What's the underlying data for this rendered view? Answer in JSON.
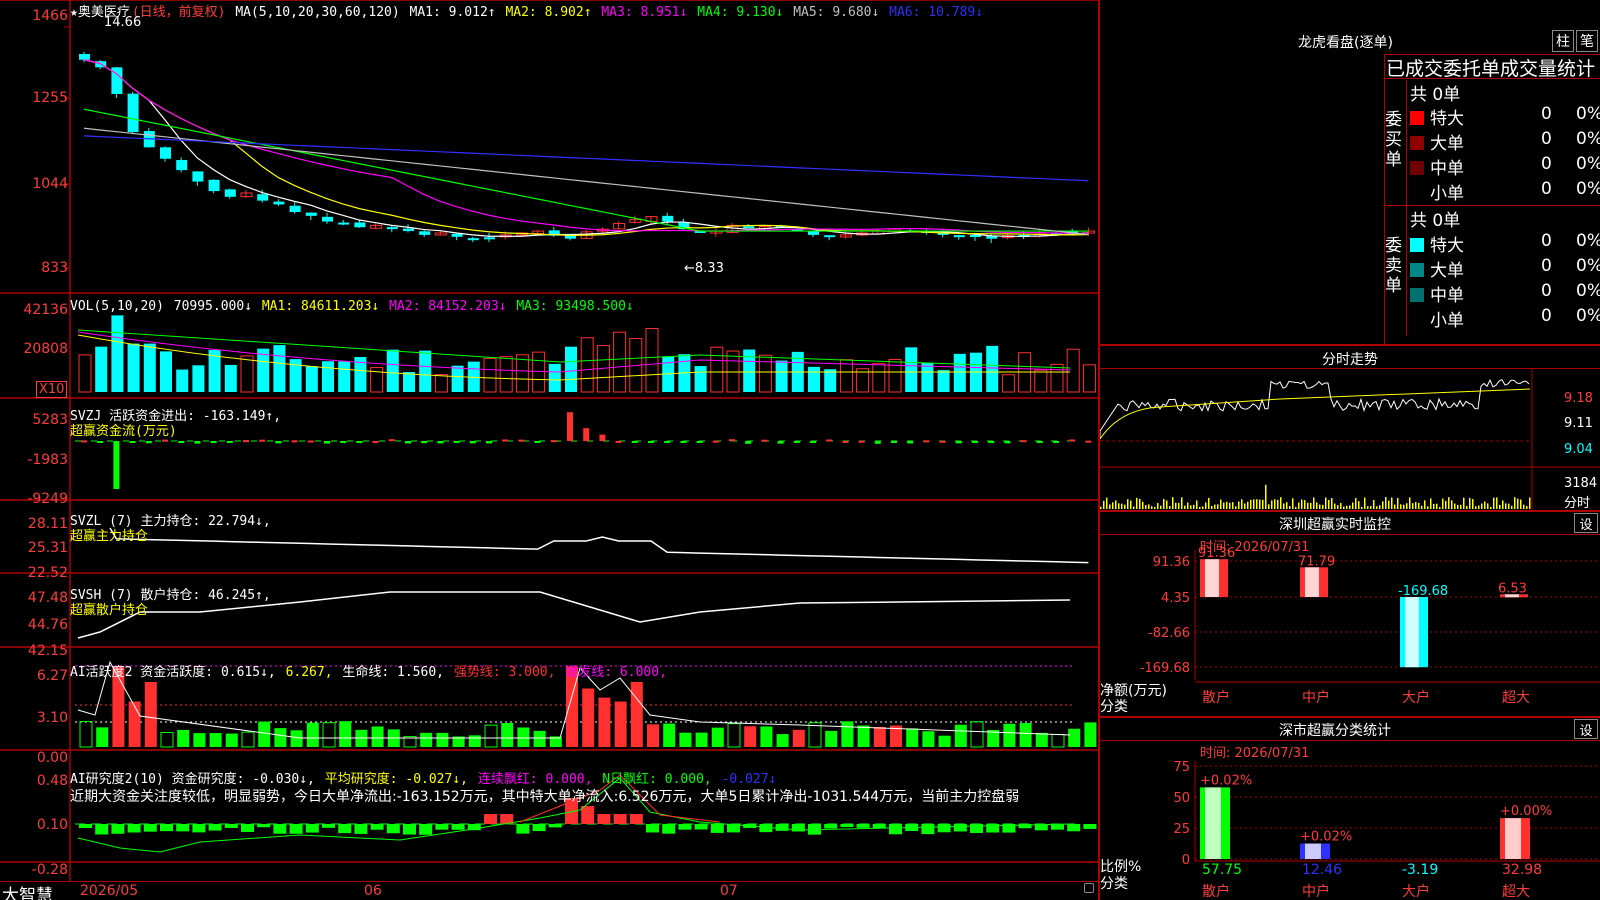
{
  "stock": {
    "name": "★奥美医疗",
    "mode": "(日线，前复权)",
    "high_label": "14.66",
    "low_label": "←8.33"
  },
  "ma": {
    "label": "MA(5,10,20,30,60,120)",
    "items": [
      {
        "text": "MA1: 9.012↑",
        "color": "#ffffff"
      },
      {
        "text": "MA2: 8.902↑",
        "color": "#ffff00"
      },
      {
        "text": "MA3: 8.951↓",
        "color": "#ff00ff"
      },
      {
        "text": "MA4: 9.130↓",
        "color": "#00ff00"
      },
      {
        "text": "MA5: 9.680↓",
        "color": "#c0c0c0"
      },
      {
        "text": "MA6: 10.789↓",
        "color": "#3030ff"
      }
    ]
  },
  "price_axis": [
    "1466",
    "1255",
    "1044",
    "833"
  ],
  "vol": {
    "label": "VOL(5,10,20)",
    "value": "70995.000↓",
    "items": [
      {
        "text": "MA1: 84611.203↓",
        "color": "#ffff00"
      },
      {
        "text": "MA2: 84152.203↓",
        "color": "#ff00ff"
      },
      {
        "text": "MA3: 93498.500↓",
        "color": "#00ff00"
      }
    ],
    "axis": [
      "42136",
      "20808"
    ],
    "unit": "X10"
  },
  "svzj": {
    "label": "SVZJ  活跃资金进出: -163.149↑,",
    "sub": "超赢资金流(万元)",
    "axis": [
      "5283",
      "-1983",
      "-9249"
    ]
  },
  "svzl": {
    "label": "SVZL (7) 主力持仓: 22.794↓,",
    "sub": "超赢主力持仓",
    "axis": [
      "28.11",
      "25.31",
      "22.52"
    ]
  },
  "svsh": {
    "label": "SVSH (7) 散户持仓: 46.245↑,",
    "sub": "超赢散户持仓",
    "axis": [
      "47.48",
      "44.76",
      "42.15"
    ]
  },
  "ai1": {
    "items": [
      {
        "text": "AI活跃度2 资金活跃度: 0.615↓,",
        "color": "#ffffff"
      },
      {
        "text": "6.267,",
        "color": "#ffff00"
      },
      {
        "text": "生命线: 1.560,",
        "color": "#ffffff"
      },
      {
        "text": "强势线: 3.000,",
        "color": "#ff3030"
      },
      {
        "text": "爆发线: 6.000,",
        "color": "#ff00ff"
      }
    ],
    "axis": [
      "6.27",
      "3.10",
      "0.00"
    ]
  },
  "ai2": {
    "items": [
      {
        "text": "AI研究度2(10) 资金研究度: -0.030↓,",
        "color": "#ffffff"
      },
      {
        "text": "平均研究度: -0.027↓,",
        "color": "#ffff00"
      },
      {
        "text": "连续飘红: 0.000,",
        "color": "#ff00ff"
      },
      {
        "text": "N日飘红: 0.000,",
        "color": "#00ff00"
      },
      {
        "text": "-0.027↓",
        "color": "#3030ff"
      }
    ],
    "desc": "近期大资金关注度较低，明显弱势，今日大单净流出:-163.152万元，其中特大单净流入:6.526万元，大单5日累计净出-1031.544万元，当前主力控盘弱",
    "axis": [
      "0.48",
      "0.10",
      "-0.28"
    ]
  },
  "date_axis": [
    "2026/05",
    "06",
    "07"
  ],
  "brand": "大智慧",
  "right": {
    "lhkp_title": "龙虎看盘(逐单)",
    "btn_bar": "柱",
    "btn_pen": "笔",
    "tabs_line": "已成交委托单成交量统计",
    "buy": {
      "group": "委买单",
      "total": "共 0单",
      "rows": [
        {
          "label": "特大",
          "count": "0",
          "pct": "0%",
          "color": "#ff0000"
        },
        {
          "label": "大单",
          "count": "0",
          "pct": "0%",
          "color": "#900000"
        },
        {
          "label": "中单",
          "count": "0",
          "pct": "0%",
          "color": "#700000"
        },
        {
          "label": "小单",
          "count": "0",
          "pct": "0%",
          "color": ""
        }
      ]
    },
    "sell": {
      "group": "委卖单",
      "total": "共 0单",
      "rows": [
        {
          "label": "特大",
          "count": "0",
          "pct": "0%",
          "color": "#00ffff"
        },
        {
          "label": "大单",
          "count": "0",
          "pct": "0%",
          "color": "#008888"
        },
        {
          "label": "中单",
          "count": "0",
          "pct": "0%",
          "color": "#007070"
        },
        {
          "label": "小单",
          "count": "0",
          "pct": "0%",
          "color": ""
        }
      ]
    },
    "fenshi": {
      "title": "分时走势",
      "axis": [
        "9.18",
        "9.11",
        "9.04"
      ],
      "vol_label": "3184",
      "vol_sub": "分时"
    },
    "sz_monitor": {
      "title": "深圳超赢实时监控",
      "btn": "设",
      "time": "时间: 2026/07/31",
      "axis": [
        "91.36",
        "4.35",
        "-82.66",
        "-169.68"
      ],
      "ylabel": "净额(万元)",
      "xlabel": "分类",
      "cats": [
        "散户",
        "中户",
        "大户",
        "超大"
      ],
      "bar_labels": [
        "91.36",
        "71.79",
        "-169.68",
        "6.53"
      ]
    },
    "sz_stat": {
      "title": "深市超赢分类统计",
      "btn": "设",
      "time": "时间: 2026/07/31",
      "axis": [
        "75",
        "50",
        "25",
        "0"
      ],
      "ylabel": "比例%",
      "xlabel": "分类",
      "cats": [
        "散户",
        "中户",
        "大户",
        "超大"
      ],
      "bar_top": [
        "+0.02%",
        "+0.02%",
        "",
        "+0.00%"
      ],
      "bottom_vals": [
        "57.75",
        "12.46",
        "-3.19",
        "32.98"
      ]
    }
  }
}
